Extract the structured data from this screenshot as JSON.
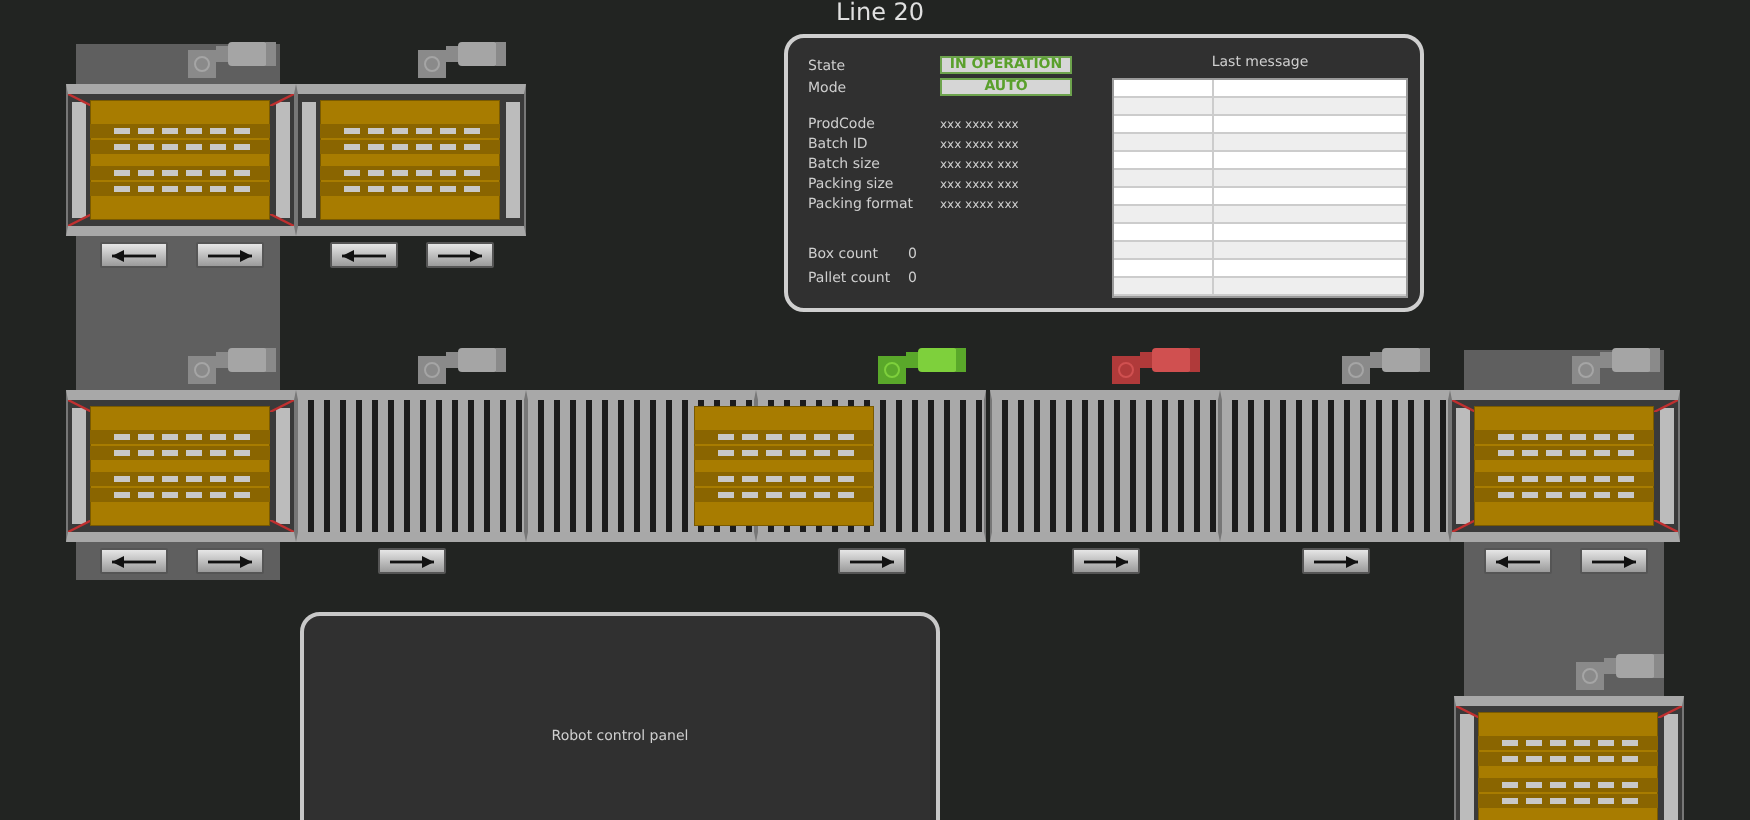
{
  "title": "Line 20",
  "status_panel": {
    "status": [
      {
        "label": "State",
        "value": "IN OPERATION"
      },
      {
        "label": "Mode",
        "value": "AUTO"
      }
    ],
    "fields": [
      {
        "label": "ProdCode",
        "value": "xxx xxxx xxx"
      },
      {
        "label": "Batch ID",
        "value": "xxx xxxx xxx"
      },
      {
        "label": "Batch size",
        "value": "xxx xxxx xxx"
      },
      {
        "label": "Packing size",
        "value": "xxx xxxx xxx"
      },
      {
        "label": "Packing format",
        "value": "xxx xxxx xxx"
      }
    ],
    "counters": [
      {
        "label": "Box count",
        "value": "0"
      },
      {
        "label": "Pallet count",
        "value": "0"
      }
    ],
    "message_table": {
      "title": "Last message"
    }
  },
  "conveyors": [
    {
      "kind": "transfer",
      "has_pallet": true,
      "motor": true,
      "running": false,
      "fault": false,
      "left_button": true,
      "right_button": true
    },
    {
      "kind": "chain",
      "has_pallet": true,
      "motor": true,
      "running": false,
      "fault": false,
      "left_button": true,
      "right_button": true
    },
    {
      "kind": "transfer",
      "has_pallet": true,
      "motor": true,
      "running": false,
      "fault": false,
      "left_button": true,
      "right_button": true
    },
    {
      "kind": "roller",
      "has_pallet": false,
      "motor": true,
      "running": false,
      "fault": false,
      "left_button": false,
      "right_button": true
    },
    {
      "kind": "roller",
      "has_pallet": true,
      "motor": false,
      "left_button": false,
      "right_button": false
    },
    {
      "kind": "roller",
      "has_pallet": false,
      "motor": true,
      "running": true,
      "fault": false,
      "left_button": false,
      "right_button": true
    },
    {
      "kind": "roller",
      "has_pallet": false,
      "motor": true,
      "running": false,
      "fault": true,
      "left_button": false,
      "right_button": true
    },
    {
      "kind": "roller",
      "has_pallet": false,
      "motor": true,
      "running": false,
      "fault": false,
      "left_button": false,
      "right_button": true
    },
    {
      "kind": "transfer",
      "has_pallet": true,
      "motor": true,
      "running": false,
      "fault": false,
      "left_button": true,
      "right_button": true
    },
    {
      "kind": "transfer",
      "has_pallet": true,
      "motor": true,
      "running": false,
      "fault": false,
      "left_button": false,
      "right_button": false
    }
  ],
  "robot_panel": {
    "label": "Robot control panel"
  }
}
